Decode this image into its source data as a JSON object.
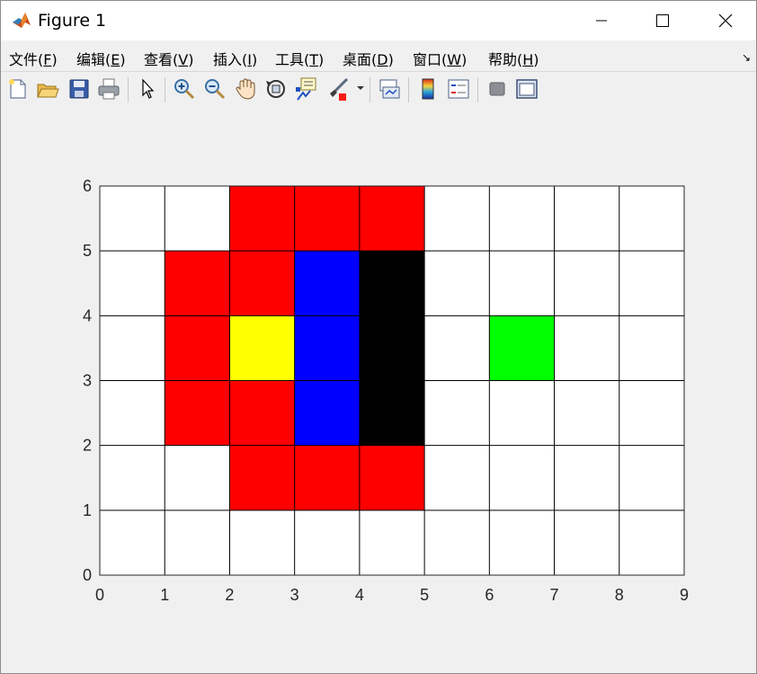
{
  "window": {
    "title": "Figure 1",
    "controls": [
      "minimize",
      "maximize",
      "close"
    ]
  },
  "menu": {
    "items": [
      {
        "label": "文件(",
        "key": "F",
        "end": ")"
      },
      {
        "label": "编辑(",
        "key": "E",
        "end": ")"
      },
      {
        "label": "查看(",
        "key": "V",
        "end": ")"
      },
      {
        "label": "插入(",
        "key": "I",
        "end": ")"
      },
      {
        "label": "工具(",
        "key": "T",
        "end": ")"
      },
      {
        "label": "桌面(",
        "key": "D",
        "end": ")"
      },
      {
        "label": "窗口(",
        "key": "W",
        "end": ")"
      },
      {
        "label": "帮助(",
        "key": "H",
        "end": ")"
      }
    ]
  },
  "toolbar": {
    "buttons": [
      "new-figure-icon",
      "open-file-icon",
      "save-icon",
      "print-icon",
      "select-arrow-icon",
      "zoom-in-icon",
      "zoom-out-icon",
      "pan-hand-icon",
      "rotate-3d-icon",
      "data-cursor-icon",
      "brush-icon",
      "link-plot-icon",
      "colorbar-icon",
      "legend-icon",
      "hide-plot-tools-icon",
      "show-plot-tools-icon"
    ]
  },
  "chart_data": {
    "type": "heatmap",
    "title": "",
    "xlabel": "",
    "ylabel": "",
    "xlim": [
      0,
      9
    ],
    "ylim": [
      0,
      6
    ],
    "xticks": [
      "0",
      "1",
      "2",
      "3",
      "4",
      "5",
      "6",
      "7",
      "8",
      "9"
    ],
    "yticks": [
      "0",
      "1",
      "2",
      "3",
      "4",
      "5",
      "6"
    ],
    "grid": true,
    "cells": [
      {
        "x": 2,
        "y": 5,
        "color": "#ff0000"
      },
      {
        "x": 3,
        "y": 5,
        "color": "#ff0000"
      },
      {
        "x": 4,
        "y": 5,
        "color": "#ff0000"
      },
      {
        "x": 1,
        "y": 4,
        "color": "#ff0000"
      },
      {
        "x": 2,
        "y": 4,
        "color": "#ff0000"
      },
      {
        "x": 3,
        "y": 4,
        "color": "#0000ff"
      },
      {
        "x": 4,
        "y": 4,
        "color": "#000000"
      },
      {
        "x": 1,
        "y": 3,
        "color": "#ff0000"
      },
      {
        "x": 2,
        "y": 3,
        "color": "#ffff00"
      },
      {
        "x": 3,
        "y": 3,
        "color": "#0000ff"
      },
      {
        "x": 4,
        "y": 3,
        "color": "#000000"
      },
      {
        "x": 6,
        "y": 3,
        "color": "#00ff00"
      },
      {
        "x": 1,
        "y": 2,
        "color": "#ff0000"
      },
      {
        "x": 2,
        "y": 2,
        "color": "#ff0000"
      },
      {
        "x": 3,
        "y": 2,
        "color": "#0000ff"
      },
      {
        "x": 4,
        "y": 2,
        "color": "#000000"
      },
      {
        "x": 2,
        "y": 1,
        "color": "#ff0000"
      },
      {
        "x": 3,
        "y": 1,
        "color": "#ff0000"
      },
      {
        "x": 4,
        "y": 1,
        "color": "#ff0000"
      }
    ]
  }
}
